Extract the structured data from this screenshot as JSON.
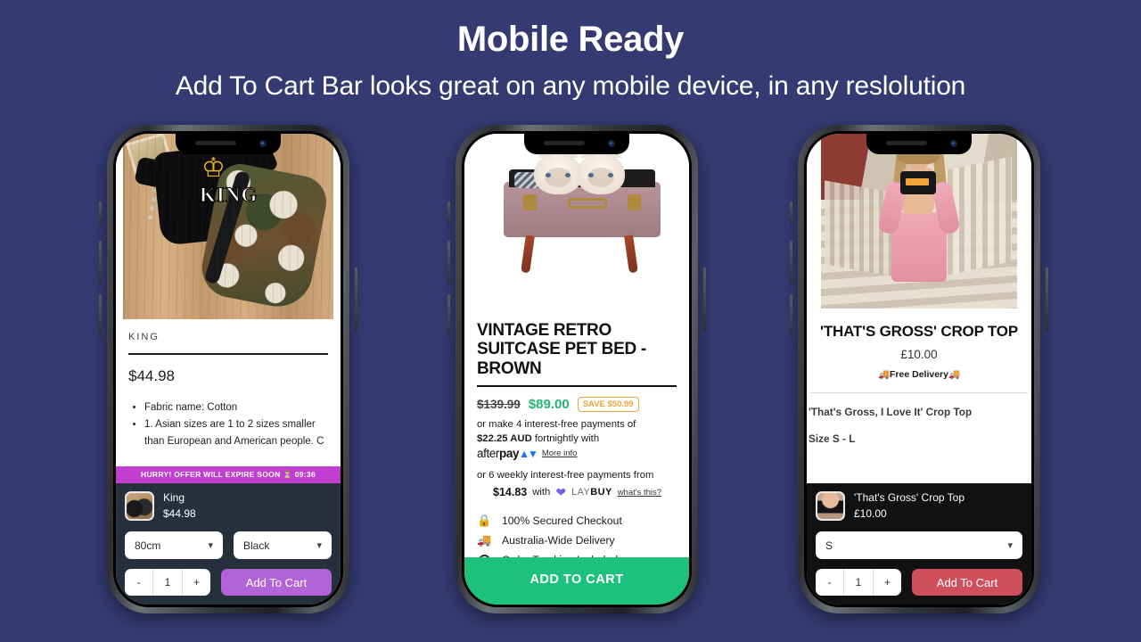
{
  "page": {
    "headline": "Mobile Ready",
    "subheadline": "Add To Cart Bar looks great on any mobile device, in any reslolution",
    "background_color": "#353a72",
    "text_color": "#ffffff"
  },
  "phones": [
    {
      "id": "phone-1",
      "theme": "dark-navy-bar",
      "hero_alt": "king-outfit-on-wood-photo",
      "product": {
        "brand": "KING",
        "price": "$44.98",
        "bullets": [
          "Fabric name: Cotton",
          "1. Asian sizes are 1 to 2 sizes smaller than European and American people. C"
        ]
      },
      "sticky_bar": {
        "hurry_text": "HURRY! OFFER WILL EXPIRE SOON",
        "hurry_icon": "hourglass-icon",
        "timer": "09:36",
        "hurry_color": "#c13fd0",
        "bar_color": "#26303c",
        "product_name": "King",
        "product_price": "$44.98",
        "select_1": "80cm",
        "select_2": "Black",
        "qty_minus": "-",
        "qty_value": "1",
        "qty_plus": "+",
        "add_to_cart": "Add To Cart",
        "add_to_cart_color": "#b263d6"
      }
    },
    {
      "id": "phone-2",
      "theme": "green-bar",
      "hero_alt": "kittens-in-vintage-suitcase-pet-bed-photo",
      "product": {
        "title": "VINTAGE RETRO SUITCASE PET BED - BROWN",
        "price_old": "$139.99",
        "price_new": "$89.00",
        "save_badge": "SAVE $50.99",
        "afterpay_line_1": "or make 4 interest-free payments of",
        "afterpay_amount": "$22.25 AUD",
        "afterpay_line_2": "fortnightly with",
        "afterpay_brand_light": "after",
        "afterpay_brand_bold": "pay",
        "afterpay_more_info": "More info",
        "laybuy_line_1": "or 6 weekly interest-free payments from",
        "laybuy_amount": "$14.83",
        "laybuy_with": "with",
        "laybuy_brand_light": "LAY",
        "laybuy_brand_bold": "BUY",
        "laybuy_link": "what's this?",
        "features": [
          {
            "icon": "lock-icon",
            "glyph": "\u0001",
            "label": "100% Secured Checkout"
          },
          {
            "icon": "truck-icon",
            "glyph": "\u0001",
            "label": "Australia-Wide Delivery"
          },
          {
            "icon": "eye-icon",
            "glyph": "\u0001",
            "label": "Order Tracking Included"
          }
        ]
      },
      "sticky_bar": {
        "add_to_cart": "ADD TO CART",
        "add_to_cart_color": "#1cc17c"
      }
    },
    {
      "id": "phone-3",
      "theme": "black-bar",
      "hero_alt": "model-in-crop-top-on-steps-photo",
      "product": {
        "title": "'THAT'S GROSS' CROP TOP",
        "price": "£10.00",
        "shipping": "Free Delivery",
        "shipping_icon": "truck-icon",
        "desc_line_1": "'That's Gross, I Love It' Crop Top",
        "desc_line_2": "Size S - L"
      },
      "sticky_bar": {
        "bar_color": "#111111",
        "product_name": "'That's Gross' Crop Top",
        "product_price": "£10.00",
        "select_1": "S",
        "qty_minus": "-",
        "qty_value": "1",
        "qty_plus": "+",
        "add_to_cart": "Add To Cart",
        "add_to_cart_color": "#cf4f5c"
      }
    }
  ]
}
